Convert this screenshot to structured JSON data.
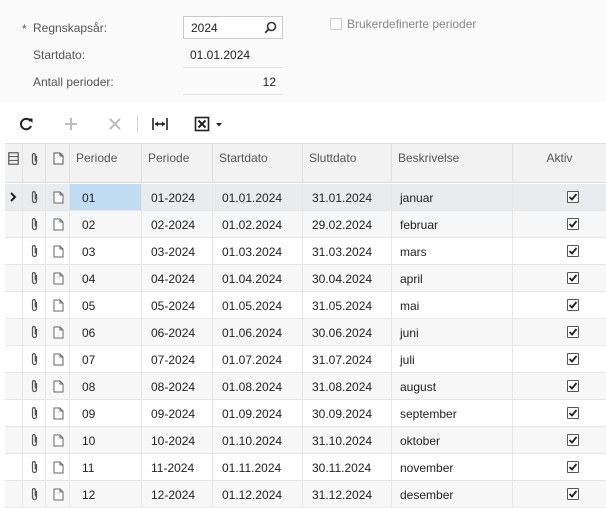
{
  "form": {
    "required_mark": "*",
    "fiscal_year_label": "Regnskapsår:",
    "fiscal_year_value": "2024",
    "start_date_label": "Startdato:",
    "start_date_value": "01.01.2024",
    "num_periods_label": "Antall perioder:",
    "num_periods_value": "12",
    "custom_periods_label": "Brukerdefinerte perioder",
    "custom_periods_checked": false
  },
  "toolbar": {
    "buttons": [
      "refresh-icon",
      "add-icon",
      "delete-icon",
      "fit-columns-icon",
      "export-excel-icon"
    ]
  },
  "grid": {
    "columns": {
      "period": "Periode",
      "period_id": "Periode",
      "start": "Startdato",
      "end": "Sluttdato",
      "desc": "Beskrivelse",
      "active": "Aktiv"
    },
    "rows": [
      {
        "period": "01",
        "period_id": "01-2024",
        "start": "01.01.2024",
        "end": "31.01.2024",
        "desc": "januar",
        "active": true
      },
      {
        "period": "02",
        "period_id": "02-2024",
        "start": "01.02.2024",
        "end": "29.02.2024",
        "desc": "februar",
        "active": true
      },
      {
        "period": "03",
        "period_id": "03-2024",
        "start": "01.03.2024",
        "end": "31.03.2024",
        "desc": "mars",
        "active": true
      },
      {
        "period": "04",
        "period_id": "04-2024",
        "start": "01.04.2024",
        "end": "30.04.2024",
        "desc": "april",
        "active": true
      },
      {
        "period": "05",
        "period_id": "05-2024",
        "start": "01.05.2024",
        "end": "31.05.2024",
        "desc": "mai",
        "active": true
      },
      {
        "period": "06",
        "period_id": "06-2024",
        "start": "01.06.2024",
        "end": "30.06.2024",
        "desc": "juni",
        "active": true
      },
      {
        "period": "07",
        "period_id": "07-2024",
        "start": "01.07.2024",
        "end": "31.07.2024",
        "desc": "juli",
        "active": true
      },
      {
        "period": "08",
        "period_id": "08-2024",
        "start": "01.08.2024",
        "end": "31.08.2024",
        "desc": "august",
        "active": true
      },
      {
        "period": "09",
        "period_id": "09-2024",
        "start": "01.09.2024",
        "end": "30.09.2024",
        "desc": "september",
        "active": true
      },
      {
        "period": "10",
        "period_id": "10-2024",
        "start": "01.10.2024",
        "end": "31.10.2024",
        "desc": "oktober",
        "active": true
      },
      {
        "period": "11",
        "period_id": "11-2024",
        "start": "01.11.2024",
        "end": "30.11.2024",
        "desc": "november",
        "active": true
      },
      {
        "period": "12",
        "period_id": "12-2024",
        "start": "01.12.2024",
        "end": "31.12.2024",
        "desc": "desember",
        "active": true
      }
    ]
  }
}
